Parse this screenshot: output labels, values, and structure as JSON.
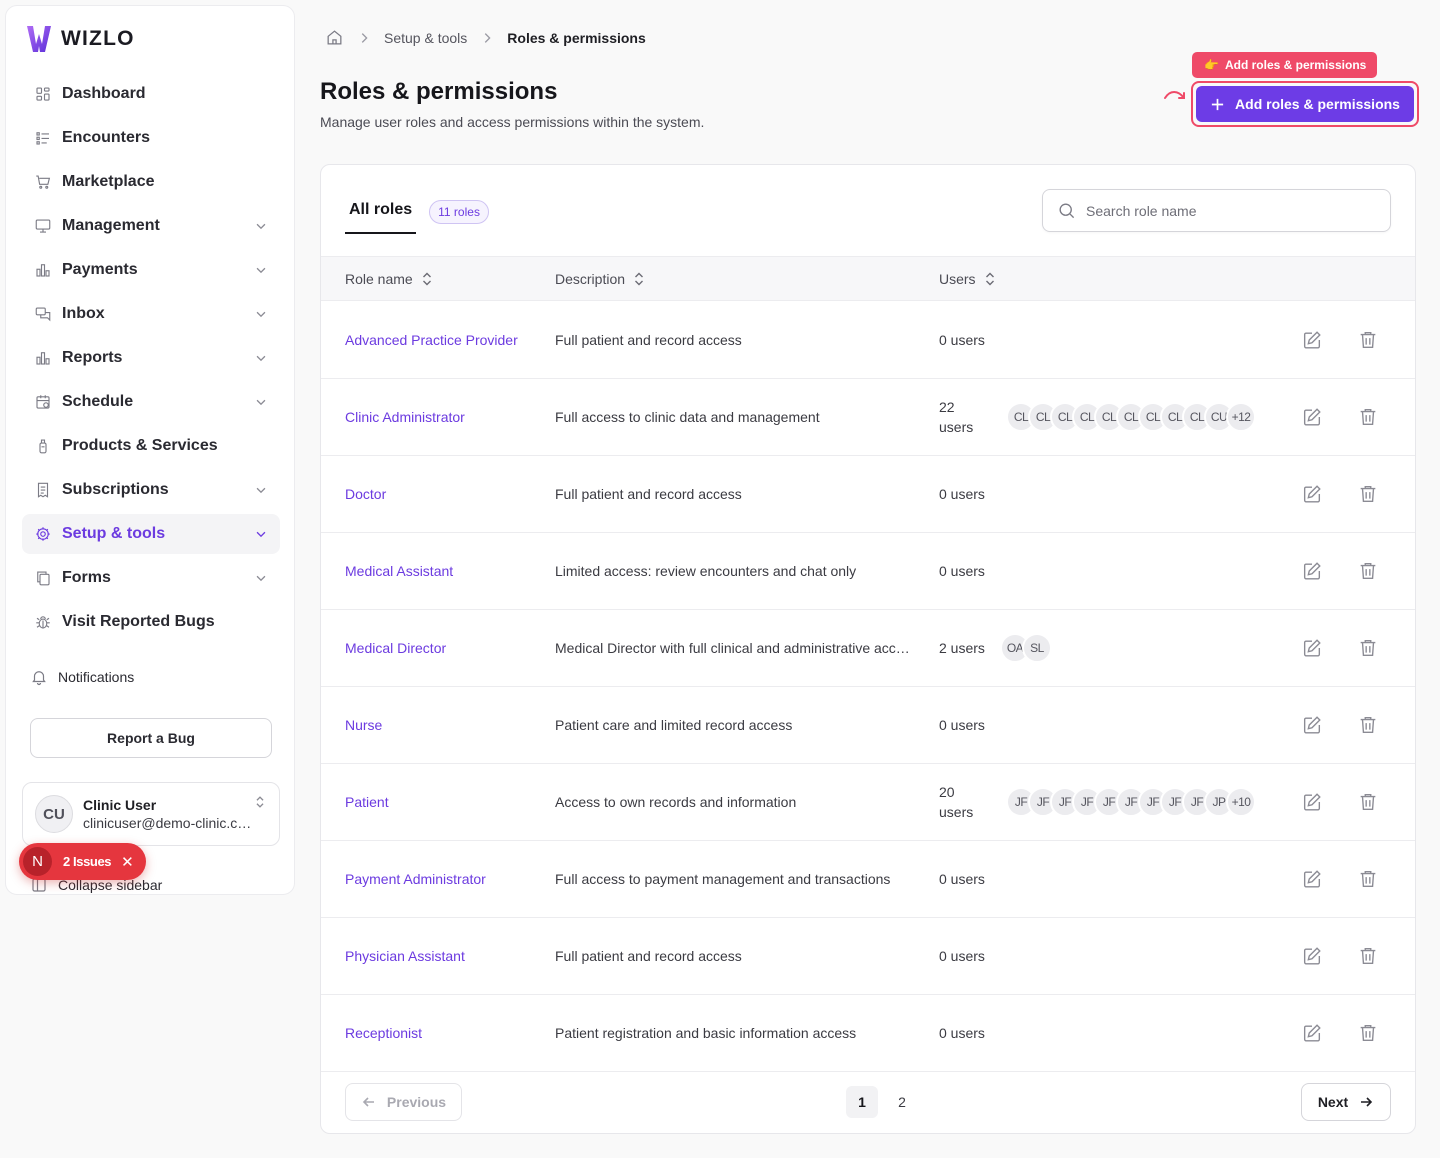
{
  "brand": {
    "name": "WIZLO",
    "color": "#6d3ce6"
  },
  "sidebar": {
    "items": [
      {
        "label": "Dashboard",
        "icon": "dashboard-icon",
        "chevron": false
      },
      {
        "label": "Encounters",
        "icon": "list-icon",
        "chevron": false
      },
      {
        "label": "Marketplace",
        "icon": "cart-icon",
        "chevron": false
      },
      {
        "label": "Management",
        "icon": "monitor-icon",
        "chevron": true
      },
      {
        "label": "Payments",
        "icon": "bar-chart-icon",
        "chevron": true
      },
      {
        "label": "Inbox",
        "icon": "chat-icon",
        "chevron": true
      },
      {
        "label": "Reports",
        "icon": "bar-chart-icon",
        "chevron": true
      },
      {
        "label": "Schedule",
        "icon": "calendar-icon",
        "chevron": true
      },
      {
        "label": "Products & Services",
        "icon": "bottle-icon",
        "chevron": false
      },
      {
        "label": "Subscriptions",
        "icon": "receipt-icon",
        "chevron": true
      },
      {
        "label": "Setup & tools",
        "icon": "gear-icon",
        "chevron": true,
        "active": true
      },
      {
        "label": "Forms",
        "icon": "copy-icon",
        "chevron": true
      },
      {
        "label": "Visit Reported Bugs",
        "icon": "bug-icon",
        "chevron": false
      }
    ],
    "notifications_label": "Notifications",
    "report_bug_label": "Report a Bug",
    "user": {
      "initials": "CU",
      "name": "Clinic User",
      "email": "clinicuser@demo-clinic.com"
    },
    "collapse_label": "Collapse sidebar",
    "issues": {
      "badge": "N",
      "label": "2 Issues"
    }
  },
  "breadcrumb": {
    "items": [
      "Setup & tools",
      "Roles & permissions"
    ]
  },
  "header": {
    "title": "Roles & permissions",
    "subtitle": "Manage user roles and access permissions within the system.",
    "tooltip": "Add roles & permissions",
    "add_button": "Add roles & permissions"
  },
  "tabs": {
    "all_label": "All roles",
    "count_badge": "11 roles"
  },
  "search": {
    "placeholder": "Search role name",
    "value": ""
  },
  "table": {
    "columns": [
      "Role name",
      "Description",
      "Users"
    ],
    "rows": [
      {
        "name": "Advanced Practice Provider",
        "description": "Full patient and record access",
        "users": "0 users",
        "avatars": [],
        "more": ""
      },
      {
        "name": "Clinic Administrator",
        "description": "Full access to clinic data and management",
        "users": "22 users",
        "avatars": [
          "CL",
          "CL",
          "CL",
          "CL",
          "CL",
          "CL",
          "CL",
          "CL",
          "CL",
          "CU"
        ],
        "more": "+12"
      },
      {
        "name": "Doctor",
        "description": "Full patient and record access",
        "users": "0 users",
        "avatars": [],
        "more": ""
      },
      {
        "name": "Medical Assistant",
        "description": "Limited access: review encounters and chat only",
        "users": "0 users",
        "avatars": [],
        "more": ""
      },
      {
        "name": "Medical Director",
        "description": "Medical Director with full clinical and administrative access",
        "users": "2 users",
        "avatars": [
          "OA",
          "SL"
        ],
        "more": ""
      },
      {
        "name": "Nurse",
        "description": "Patient care and limited record access",
        "users": "0 users",
        "avatars": [],
        "more": ""
      },
      {
        "name": "Patient",
        "description": "Access to own records and information",
        "users": "20 users",
        "avatars": [
          "JF",
          "JF",
          "JF",
          "JF",
          "JF",
          "JF",
          "JF",
          "JF",
          "JF",
          "JP"
        ],
        "more": "+10"
      },
      {
        "name": "Payment Administrator",
        "description": "Full access to payment management and transactions",
        "users": "0 users",
        "avatars": [],
        "more": ""
      },
      {
        "name": "Physician Assistant",
        "description": "Full patient and record access",
        "users": "0 users",
        "avatars": [],
        "more": ""
      },
      {
        "name": "Receptionist",
        "description": "Patient registration and basic information access",
        "users": "0 users",
        "avatars": [],
        "more": ""
      }
    ]
  },
  "pagination": {
    "previous": "Previous",
    "next": "Next",
    "pages": [
      "1",
      "2"
    ],
    "current": "1"
  }
}
